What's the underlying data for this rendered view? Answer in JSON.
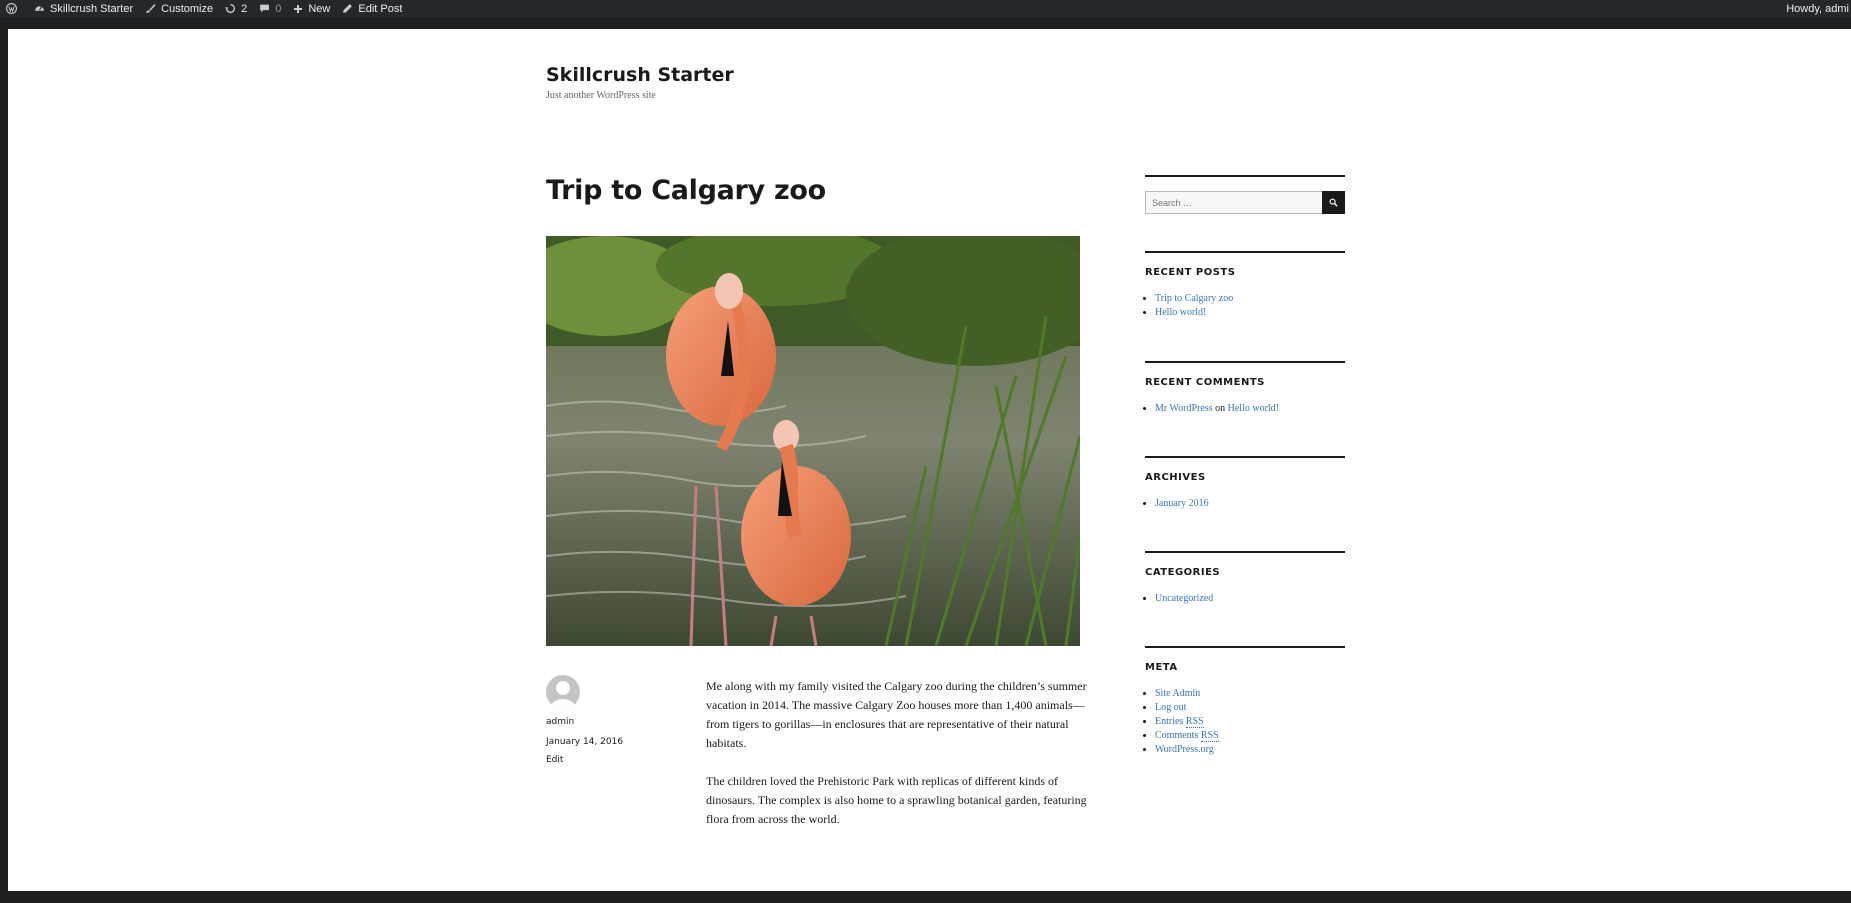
{
  "adminbar": {
    "site_name": "Skillcrush Starter",
    "customize": "Customize",
    "updates_count": "2",
    "comments_count": "0",
    "new": "New",
    "edit_post": "Edit Post",
    "howdy": "Howdy, admi"
  },
  "site": {
    "title": "Skillcrush Starter",
    "description": "Just another WordPress site"
  },
  "post": {
    "title": "Trip to Calgary zoo",
    "author": "admin",
    "date": "January 14, 2016",
    "edit": "Edit",
    "paragraphs": [
      "Me along with my family visited the Calgary zoo during the  children’s summer vacation in 2014. The massive Calgary Zoo houses more than 1,400 animals—from tigers to gorillas—in enclosures that are representative of their natural habitats.",
      "The children loved the Prehistoric Park with replicas of different kinds of dinosaurs. The complex is also home to a sprawling botanical garden, featuring flora from across the world."
    ]
  },
  "sidebar": {
    "search_placeholder": "Search …",
    "recent_posts": {
      "title": "RECENT POSTS",
      "items": [
        "Trip to Calgary zoo",
        "Hello world!"
      ]
    },
    "recent_comments": {
      "title": "RECENT COMMENTS",
      "author": "Mr WordPress",
      "on": "on",
      "post": "Hello world!"
    },
    "archives": {
      "title": "ARCHIVES",
      "items": [
        "January 2016"
      ]
    },
    "categories": {
      "title": "CATEGORIES",
      "items": [
        "Uncategorized"
      ]
    },
    "meta": {
      "title": "META",
      "site_admin": "Site Admin",
      "log_out": "Log out",
      "entries": "Entries",
      "comments": "Comments",
      "rss": "RSS",
      "wordpress_org": "WordPress.org"
    }
  },
  "colors": {
    "link": "#3b73b9",
    "admin_bar": "#23282d",
    "text": "#1a1a1a"
  }
}
